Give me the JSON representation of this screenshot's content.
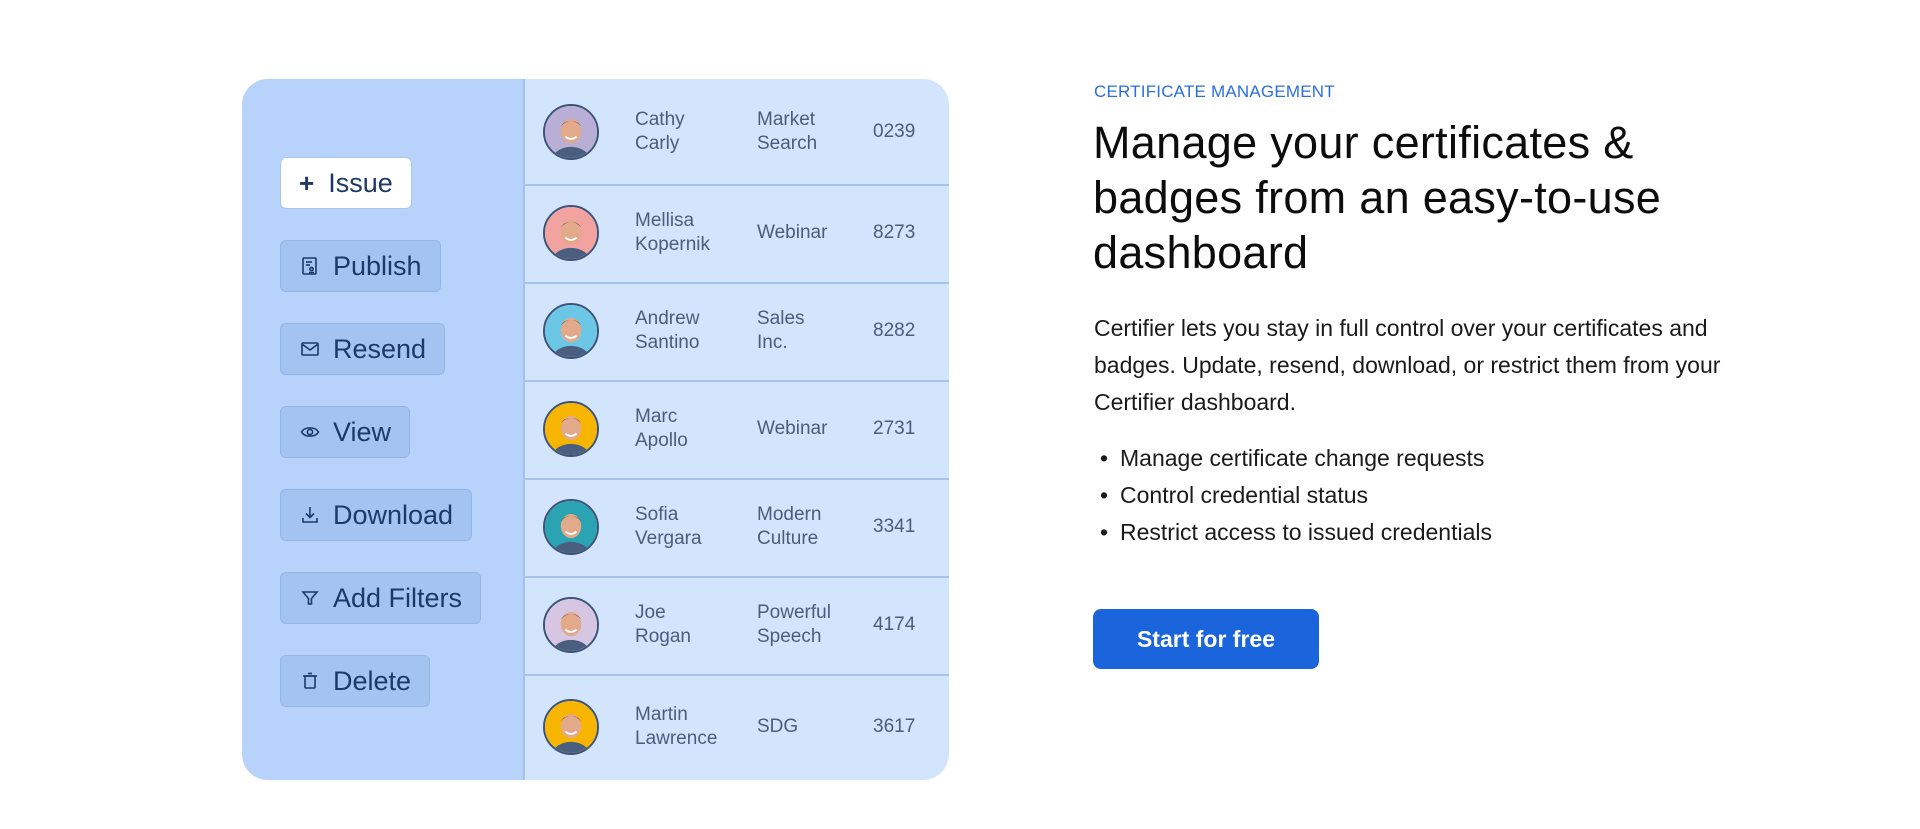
{
  "dashboard": {
    "actions": [
      {
        "label": "Issue",
        "icon": "plus-icon",
        "primary": true
      },
      {
        "label": "Publish",
        "icon": "publish-document-icon"
      },
      {
        "label": "Resend",
        "icon": "envelope-icon"
      },
      {
        "label": "View",
        "icon": "eye-icon"
      },
      {
        "label": "Download",
        "icon": "download-icon"
      },
      {
        "label": "Add Filters",
        "icon": "filter-icon"
      },
      {
        "label": "Delete",
        "icon": "trash-icon"
      }
    ],
    "recipients": [
      {
        "first": "Cathy",
        "last": "Carly",
        "event1": "Market",
        "event2": "Search",
        "code": "0239",
        "avatar_bg": "#b9aed6"
      },
      {
        "first": "Mellisa",
        "last": "Kopernik",
        "event1": "Webinar",
        "event2": "",
        "code": "8273",
        "avatar_bg": "#f2a29f"
      },
      {
        "first": "Andrew",
        "last": "Santino",
        "event1": "Sales",
        "event2": "Inc.",
        "code": "8282",
        "avatar_bg": "#6cc7e6"
      },
      {
        "first": "Marc",
        "last": "Apollo",
        "event1": "Webinar",
        "event2": "",
        "code": "2731",
        "avatar_bg": "#f7b500"
      },
      {
        "first": "Sofia",
        "last": "Vergara",
        "event1": "Modern",
        "event2": "Culture",
        "code": "3341",
        "avatar_bg": "#2aa3b3"
      },
      {
        "first": "Joe",
        "last": "Rogan",
        "event1": "Powerful",
        "event2": "Speech",
        "code": "4174",
        "avatar_bg": "#d7c6e2"
      },
      {
        "first": "Martin",
        "last": "Lawrence",
        "event1": "SDG",
        "event2": "",
        "code": "3617",
        "avatar_bg": "#f7b500"
      }
    ]
  },
  "content": {
    "eyebrow": "CERTIFICATE MANAGEMENT",
    "headline": "Manage your certificates & badges from an easy-to-use dashboard",
    "description": "Certifier lets you stay in full control over your certificates and badges. Update, resend, download, or restrict them from your Certifier dashboard.",
    "bullets": [
      "Manage certificate change requests",
      "Control credential status",
      "Restrict access to issued credentials"
    ],
    "cta_label": "Start for free"
  },
  "colors": {
    "accent": "#1a64dc",
    "eyebrow": "#2b6fde",
    "panel_left": "#b8d3fb",
    "panel_right": "#d3e4fd"
  }
}
